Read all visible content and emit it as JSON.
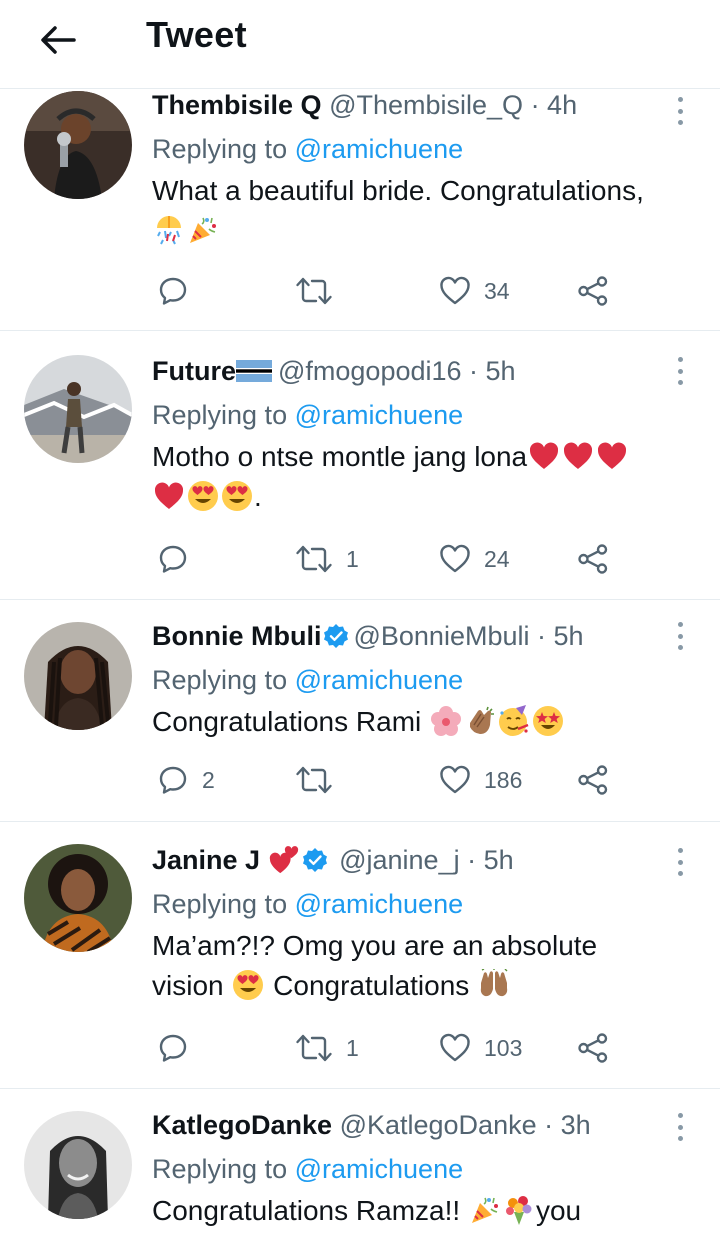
{
  "header": {
    "title": "Tweet"
  },
  "tweets": [
    {
      "name": "Thembisile Q",
      "handle": "@Thembisile_Q",
      "time": "· 4h",
      "replying_label": "Replying to",
      "mention": "@ramichuene",
      "text": "What a beautiful bride. Congratulations,",
      "emojis": [
        "confetti-ball-emoji",
        "party-popper-emoji"
      ],
      "reply_count": "",
      "retweet_count": "",
      "like_count": "34"
    },
    {
      "name": "Future",
      "handle": "@fmogopodi16",
      "time": "· 5h",
      "replying_label": "Replying to",
      "mention": "@ramichuene",
      "text": "Motho o ntse montle jang lona",
      "emojis": [
        "red-heart-emoji",
        "red-heart-emoji",
        "red-heart-emoji",
        "red-heart-emoji",
        "heart-eyes-emoji",
        "heart-eyes-emoji"
      ],
      "trailing": ".",
      "reply_count": "",
      "retweet_count": "1",
      "like_count": "24"
    },
    {
      "name": "Bonnie Mbuli",
      "handle": "@BonnieMbuli",
      "time": "· 5h",
      "replying_label": "Replying to",
      "mention": "@ramichuene",
      "text": "Congratulations Rami",
      "emojis": [
        "hibiscus-emoji",
        "clapping-hands-emoji",
        "partying-face-emoji",
        "star-struck-emoji"
      ],
      "reply_count": "2",
      "retweet_count": "",
      "like_count": "186"
    },
    {
      "name": "Janine J",
      "handle": "@janine_j",
      "time": "· 5h",
      "replying_label": "Replying to",
      "mention": "@ramichuene",
      "text_line1": "Ma’am?!? Omg you are an absolute",
      "text_line2a": "vision",
      "text_line2b": "Congratulations",
      "emojis": [
        "heart-eyes-emoji",
        "raising-hands-emoji"
      ],
      "reply_count": "",
      "retweet_count": "1",
      "like_count": "103"
    },
    {
      "name": "KatlegoDanke",
      "handle": "@KatlegoDanke",
      "time": "· 3h",
      "replying_label": "Replying to",
      "mention": "@ramichuene",
      "text": "Congratulations Ramza!!",
      "text_tail": "you",
      "emojis": [
        "party-popper-emoji",
        "bouquet-emoji"
      ]
    }
  ],
  "colors": {
    "link": "#1d9bf0",
    "secondary": "#536471",
    "divider": "#e6ecf0",
    "verified": "#1d9bf0"
  }
}
